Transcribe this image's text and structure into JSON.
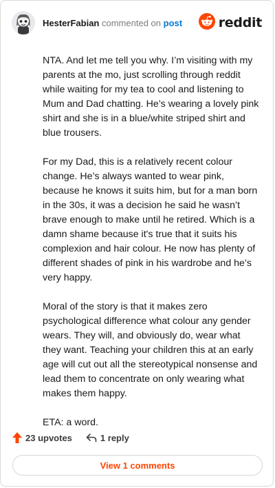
{
  "header": {
    "username": "HesterFabian",
    "action": "commented on",
    "post_link": "post",
    "brand": "reddit",
    "avatar_icon": "snoo-avatar-icon",
    "brand_icon": "reddit-alien-icon",
    "brand_color": "#ff4500"
  },
  "comment": {
    "paragraphs": [
      "NTA. And let me tell you why. I’m visiting with my parents at the mo, just scrolling through reddit while waiting for my tea to cool and listening to Mum and Dad chatting. He’s wearing a lovely pink shirt and she is in a blue/white striped shirt and blue trousers.",
      "For my Dad, this is a relatively recent colour change. He’s always wanted to wear pink, because he knows it suits him, but for a man born in the 30s, it was a decision he said he wasn’t brave enough to make until he retired. Which is a damn shame because it's true that it suits his complexion and hair colour. He now has plenty of different shades of pink in his wardrobe and he’s very happy.",
      "Moral of the story is that it makes zero psychological difference what colour any gender wears. They will, and obviously do, wear what they want. Teaching your children this at an early age will cut out all the stereotypical nonsense and lead them to concentrate on only wearing what makes them happy.",
      "ETA: a word."
    ]
  },
  "footer": {
    "upvotes": "23 upvotes",
    "upvote_icon": "upvote-arrow-icon",
    "replies": "1 reply",
    "reply_icon": "reply-arrow-icon",
    "view_comments": "View 1 comments"
  }
}
